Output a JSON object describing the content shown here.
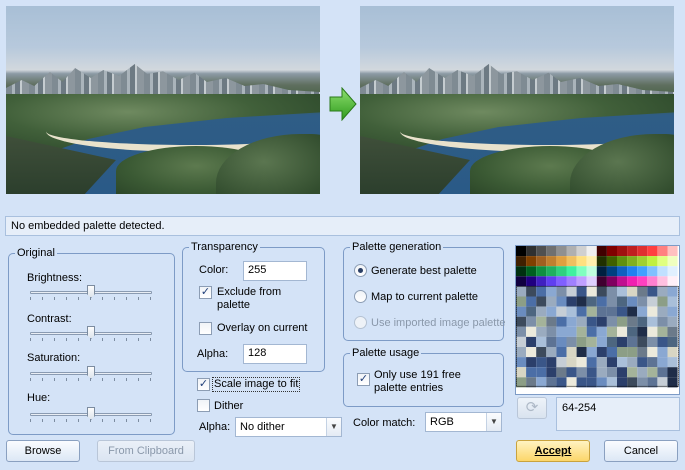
{
  "status_text": "No embedded palette detected.",
  "original": {
    "title": "Original",
    "sliders": [
      {
        "label": "Brightness:",
        "value": 0.5
      },
      {
        "label": "Contrast:",
        "value": 0.5
      },
      {
        "label": "Saturation:",
        "value": 0.5
      },
      {
        "label": "Hue:",
        "value": 0.5
      }
    ]
  },
  "transparency": {
    "title": "Transparency",
    "color_label": "Color:",
    "color_value": "255",
    "exclude_label": "Exclude from palette",
    "exclude_checked": true,
    "overlay_label": "Overlay on current",
    "overlay_checked": false,
    "alpha_label": "Alpha:",
    "alpha_value": "128"
  },
  "scale_label": "Scale image to fit",
  "scale_checked": true,
  "dither_label": "Dither",
  "dither_checked": false,
  "dither_alpha_label": "Alpha:",
  "dither_alpha_value": "No dither",
  "palette_generation": {
    "title": "Palette generation",
    "options": [
      {
        "label": "Generate best palette",
        "selected": true,
        "disabled": false
      },
      {
        "label": "Map to current palette",
        "selected": false,
        "disabled": false
      },
      {
        "label": "Use imported image palette",
        "selected": false,
        "disabled": true
      }
    ]
  },
  "palette_usage": {
    "title": "Palette usage",
    "free_label": "Only use 191 free palette entries",
    "free_checked": true
  },
  "color_match_label": "Color match:",
  "color_match_value": "RGB",
  "palette_range": "64-254",
  "buttons": {
    "browse": "Browse",
    "from_clipboard": "From Clipboard",
    "accept": "Accept",
    "cancel": "Cancel"
  },
  "colors": {
    "background": "#d4e3f7",
    "group_border": "#7d9bc6",
    "accept_button": "#fcd66a",
    "arrow": "#3fae2a"
  },
  "icons": [
    "right-arrow-icon",
    "refresh-icon",
    "check-icon"
  ]
}
